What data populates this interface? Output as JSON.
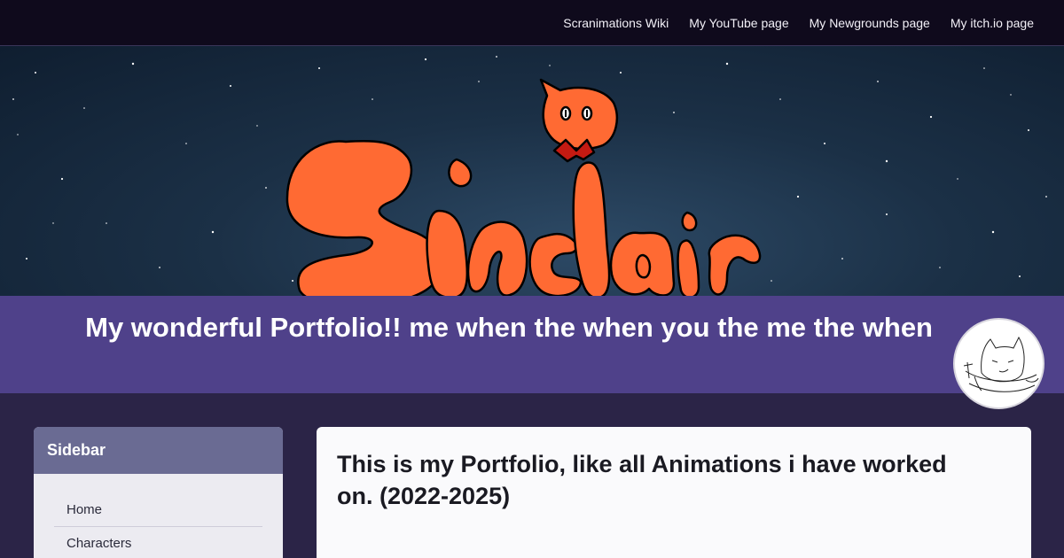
{
  "topnav": {
    "links": [
      "Scranimations Wiki",
      "My YouTube page",
      "My Newgrounds page",
      "My itch.io page"
    ]
  },
  "banner": {
    "logo_text": "Sinclair",
    "colors": {
      "logo_fill": "#ff6a33",
      "outline": "#000000",
      "bow": "#c41a12"
    }
  },
  "title": "My wonderful Portfolio!! me when the when you the me the when",
  "sidebar": {
    "heading": "Sidebar",
    "items": [
      "Home",
      "Characters"
    ]
  },
  "content": {
    "heading": "This is my Portfolio, like all Animations i have worked on. (2022-2025)"
  }
}
